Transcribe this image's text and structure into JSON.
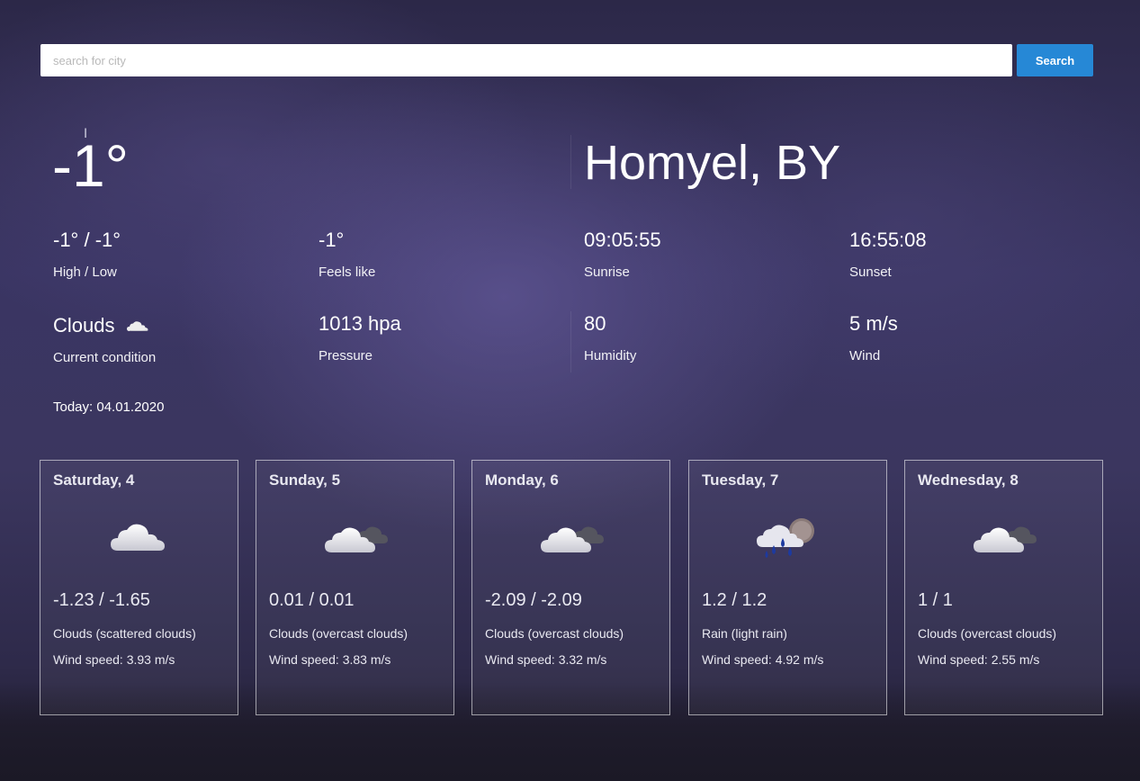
{
  "search": {
    "placeholder": "search for city",
    "value": "",
    "button_label": "Search"
  },
  "current": {
    "temperature": "-1°",
    "city": "Homyel, BY",
    "stats": [
      {
        "id": "high-low",
        "value": "-1° / -1°",
        "label": "High / Low"
      },
      {
        "id": "feels-like",
        "value": "-1°",
        "label": "Feels like"
      },
      {
        "id": "sunrise",
        "value": "09:05:55",
        "label": "Sunrise"
      },
      {
        "id": "sunset",
        "value": "16:55:08",
        "label": "Sunset"
      },
      {
        "id": "condition",
        "value": "Clouds",
        "label": "Current condition",
        "icon": "cloud-icon"
      },
      {
        "id": "pressure",
        "value": "1013 hpa",
        "label": "Pressure"
      },
      {
        "id": "humidity",
        "value": "80",
        "label": "Humidity"
      },
      {
        "id": "wind",
        "value": "5 m/s",
        "label": "Wind"
      }
    ],
    "today": "Today: 04.01.2020"
  },
  "forecast": [
    {
      "day": "Saturday, 4",
      "temps": "-1.23 / -1.65",
      "description": "Clouds (scattered clouds)",
      "wind": "Wind speed: 3.93 m/s",
      "icon": "cloud-icon"
    },
    {
      "day": "Sunday, 5",
      "temps": "0.01 / 0.01",
      "description": "Clouds (overcast clouds)",
      "wind": "Wind speed: 3.83 m/s",
      "icon": "overcast-clouds-icon"
    },
    {
      "day": "Monday, 6",
      "temps": "-2.09 / -2.09",
      "description": "Clouds (overcast clouds)",
      "wind": "Wind speed: 3.32 m/s",
      "icon": "overcast-clouds-icon"
    },
    {
      "day": "Tuesday, 7",
      "temps": "1.2 / 1.2",
      "description": "Rain (light rain)",
      "wind": "Wind speed: 4.92 m/s",
      "icon": "light-rain-icon"
    },
    {
      "day": "Wednesday, 8",
      "temps": "1 / 1",
      "description": "Clouds (overcast clouds)",
      "wind": "Wind speed: 2.55 m/s",
      "icon": "overcast-clouds-icon"
    }
  ]
}
